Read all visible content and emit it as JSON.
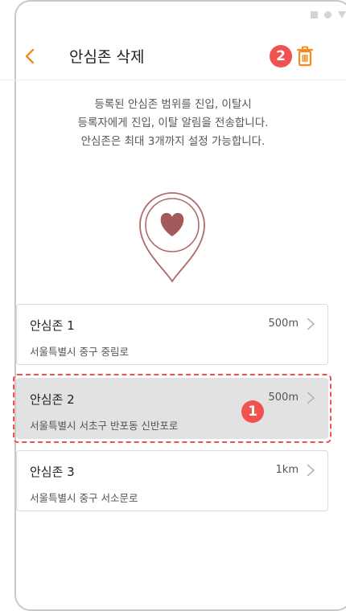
{
  "header": {
    "title": "안심존 삭제",
    "annotation_badge": "2"
  },
  "description": {
    "line1": "등록된 안심존 범위를 진입, 이탈시",
    "line2": "등록자에게 진입, 이탈 알림을 전송합니다.",
    "line3": "안심존은 최대 3개까지 설정 가능합니다."
  },
  "zones": [
    {
      "name": "안심존 1",
      "address": "서울특별시 중구 중림로",
      "distance": "500m"
    },
    {
      "name": "안심존 2",
      "address": "서울특별시 서초구 반포동 신반포로",
      "distance": "500m",
      "selected": true
    },
    {
      "name": "안심존 3",
      "address": "서울특별시 중구 서소문로",
      "distance": "1km"
    }
  ],
  "selection_badge": "1",
  "colors": {
    "accent": "#f28c1e",
    "annotation": "#f0524f",
    "heart": "#a35a5a",
    "selected_bg": "#e2e2e2"
  }
}
